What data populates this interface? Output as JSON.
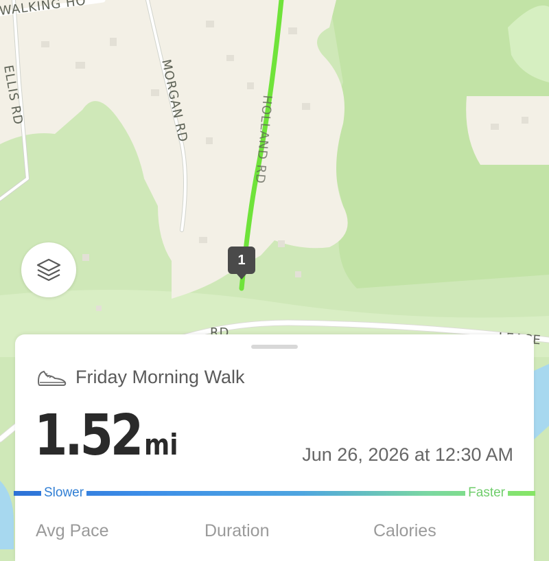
{
  "map": {
    "road_labels": [
      "WALKING HO",
      "ELLIS RD",
      "MORGAN RD",
      "HOLLAND RD",
      "RD",
      "LEACE"
    ],
    "route_marker": "1",
    "route_color": "#6fe33a",
    "layers_button_icon": "layers-icon"
  },
  "activity": {
    "icon": "shoe-icon",
    "title": "Friday Morning Walk",
    "distance_value": "1.52",
    "distance_unit": "mi",
    "datetime": "Jun 26, 2026 at 12:30 AM"
  },
  "pace_legend": {
    "slower_label": "Slower",
    "faster_label": "Faster",
    "slower_color": "#2f7ed4",
    "faster_color": "#86e564"
  },
  "stats": {
    "labels": [
      "Avg Pace",
      "Duration",
      "Calories"
    ]
  }
}
